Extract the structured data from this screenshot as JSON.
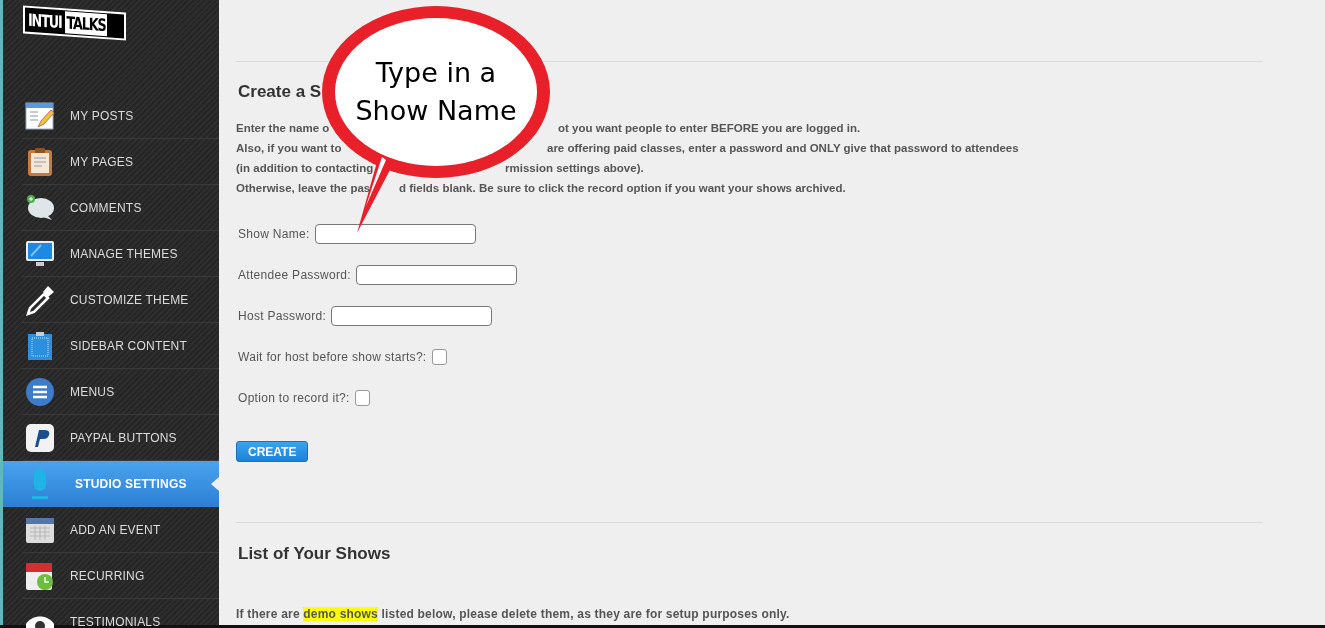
{
  "sidebar": {
    "logo": [
      "INTUI",
      "TALKS"
    ],
    "items": [
      {
        "label": "MY POSTS",
        "selected": false
      },
      {
        "label": "MY PAGES",
        "selected": false
      },
      {
        "label": "COMMENTS",
        "selected": false
      },
      {
        "label": "MANAGE THEMES",
        "selected": false
      },
      {
        "label": "CUSTOMIZE THEME",
        "selected": false
      },
      {
        "label": "SIDEBAR CONTENT",
        "selected": false
      },
      {
        "label": "MENUS",
        "selected": false
      },
      {
        "label": "PAYPAL BUTTONS",
        "selected": false
      },
      {
        "label": "STUDIO SETTINGS",
        "selected": true
      },
      {
        "label": "ADD AN EVENT",
        "selected": false
      },
      {
        "label": "RECURRING",
        "selected": false
      },
      {
        "label": "TESTIMONIALS",
        "selected": false
      }
    ]
  },
  "create_section": {
    "heading": "Create a S",
    "intro_lines": [
      [
        "Enter the name o",
        "ot you want people to enter BEFORE you are logged in."
      ],
      [
        "Also, if you want to",
        "are offering paid classes, enter a password and ONLY give that password to attendees"
      ],
      [
        "(in addition to contacting",
        "rmission settings above)."
      ],
      [
        "Otherwise, leave the pas",
        "d fields blank. Be sure to click the record option if you want your shows archived."
      ]
    ],
    "fields": [
      {
        "kind": "text",
        "label": "Show Name:"
      },
      {
        "kind": "text",
        "label": "Attendee Password:"
      },
      {
        "kind": "text",
        "label": "Host Password:"
      },
      {
        "kind": "checkbox",
        "label": "Wait for host before show starts?:",
        "checked": false
      },
      {
        "kind": "checkbox",
        "label": "Option to record it?:",
        "checked": false
      }
    ],
    "button": "CREATE"
  },
  "list_section": {
    "heading": "List of Your Shows",
    "note": {
      "before": "If there are ",
      "highlight": "demo shows",
      "after": " listed below, please delete them, as they are for setup purposes only."
    }
  },
  "callout": {
    "lines": [
      "Type in a",
      "Show Name"
    ]
  }
}
